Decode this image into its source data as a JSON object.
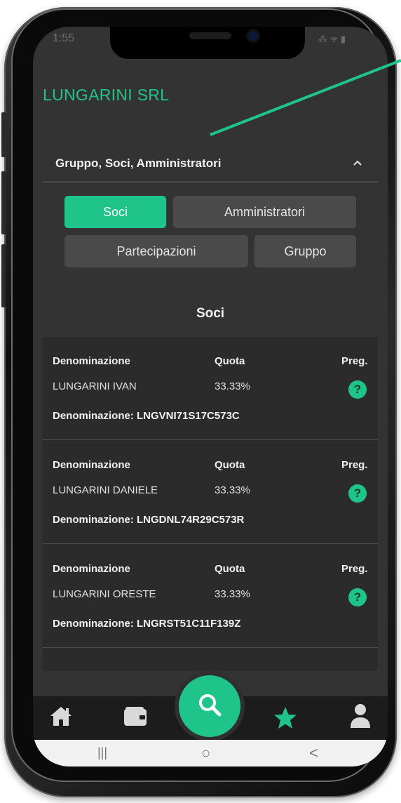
{
  "status_bar": {
    "time": "1:55",
    "right": "⁂ ᯤ ▮"
  },
  "header": {
    "company_name": "LUNGARINI SRL"
  },
  "accordion": {
    "title": "Gruppo, Soci, Amministratori"
  },
  "tabs": [
    {
      "label": "Soci",
      "active": true
    },
    {
      "label": "Amministratori",
      "active": false
    },
    {
      "label": "Partecipazioni",
      "active": false
    },
    {
      "label": "Gruppo",
      "active": false
    }
  ],
  "section": {
    "title": "Soci"
  },
  "columns": {
    "name": "Denominazione",
    "quota": "Quota",
    "preg": "Preg."
  },
  "soci": [
    {
      "name": "LUNGARINI IVAN",
      "quota": "33.33%",
      "cf_line": "Denominazione: LNGVNI71S17C573C",
      "preg_icon": "?"
    },
    {
      "name": "LUNGARINI DANIELE",
      "quota": "33.33%",
      "cf_line": "Denominazione: LNGDNL74R29C573R",
      "preg_icon": "?"
    },
    {
      "name": "LUNGARINI ORESTE",
      "quota": "33.33%",
      "cf_line": "Denominazione: LNGRST51C11F139Z",
      "preg_icon": "?"
    }
  ],
  "bottom_nav": {
    "items": [
      "home-icon",
      "wallet-icon",
      "search-icon",
      "star-icon",
      "user-icon"
    ],
    "active": "star-icon"
  },
  "system_nav": {
    "recent": "|||",
    "home": "○",
    "back": "<"
  },
  "colors": {
    "accent": "#1ec48a",
    "background": "#333333",
    "card": "#2b2b2b",
    "tab_inactive": "#4a4a4a"
  }
}
